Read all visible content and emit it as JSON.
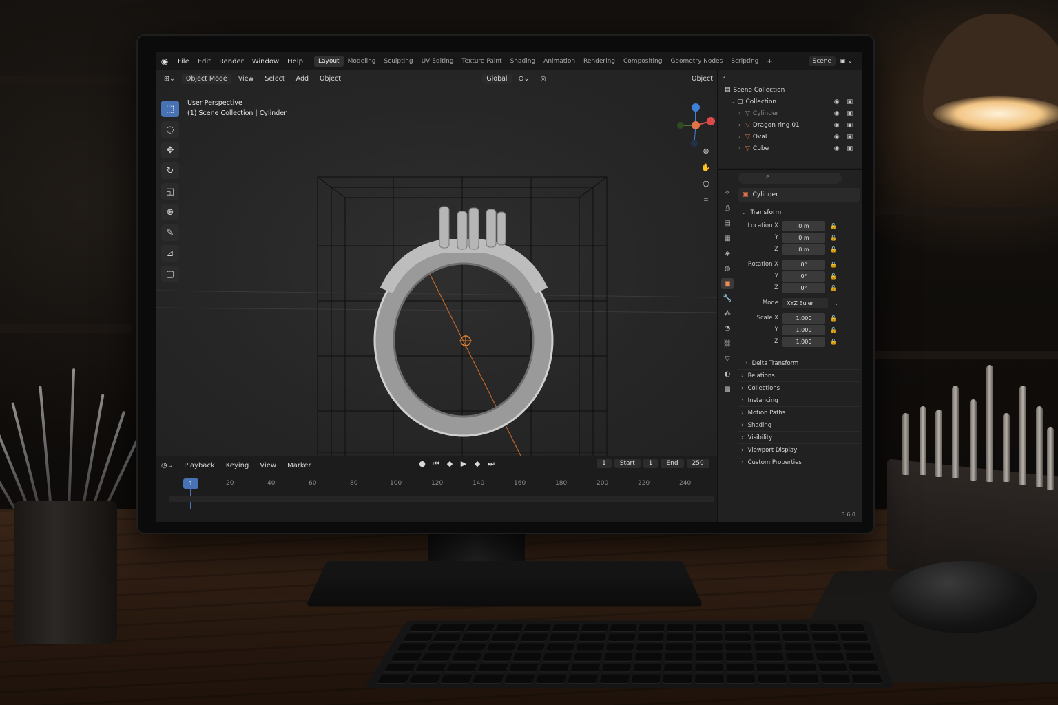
{
  "topbar": {
    "menu": [
      "File",
      "Edit",
      "Render",
      "Window",
      "Help"
    ],
    "workspaces": [
      "Layout",
      "Modeling",
      "Sculpting",
      "UV Editing",
      "Texture Paint",
      "Shading",
      "Animation",
      "Rendering",
      "Compositing",
      "Geometry Nodes",
      "Scripting"
    ],
    "active_workspace": "Layout",
    "add_tab": "+",
    "scene_name": "Scene"
  },
  "viewport": {
    "mode": "Object Mode",
    "menu": [
      "View",
      "Select",
      "Add",
      "Object"
    ],
    "transform_orientation": "Global",
    "right_label": "Object",
    "info_line1": "User Perspective",
    "info_line2": "(1) Scene Collection | Cylinder"
  },
  "timeline": {
    "menu": [
      "Playback",
      "Keying",
      "View",
      "Marker"
    ],
    "current_frame": "1",
    "start_label": "Start",
    "start_value": "1",
    "end_label": "End",
    "end_value": "250",
    "frame_field": "1",
    "ticks": [
      "20",
      "40",
      "60",
      "80",
      "100",
      "120",
      "140",
      "160",
      "180",
      "200",
      "220",
      "240"
    ]
  },
  "outliner": {
    "root": "Scene Collection",
    "collection": "Collection",
    "objects": [
      "Cylinder",
      "Dragon ring 01",
      "Oval",
      "Cube"
    ]
  },
  "properties": {
    "object_name": "Cylinder",
    "transform_label": "Transform",
    "location_label": "Location X",
    "rotation_label": "Rotation X",
    "scale_label": "Scale X",
    "axis_y": "Y",
    "axis_z": "Z",
    "location": [
      "0 m",
      "0 m",
      "0 m"
    ],
    "rotation": [
      "0°",
      "0°",
      "0°"
    ],
    "mode_label": "Mode",
    "mode_value": "XYZ Euler",
    "scale": [
      "1.000",
      "1.000",
      "1.000"
    ],
    "sections": [
      "Delta Transform",
      "Relations",
      "Collections",
      "Instancing",
      "Motion Paths",
      "Shading",
      "Visibility",
      "Viewport Display",
      "Custom Properties"
    ],
    "version": "3.6.0"
  },
  "colors": {
    "accent_blue": "#4772b3",
    "object_orange": "#e3744a",
    "axis_x_red": "#d94a4a",
    "axis_y_green": "#7fbf3f",
    "axis_z_blue": "#3f80d9"
  }
}
